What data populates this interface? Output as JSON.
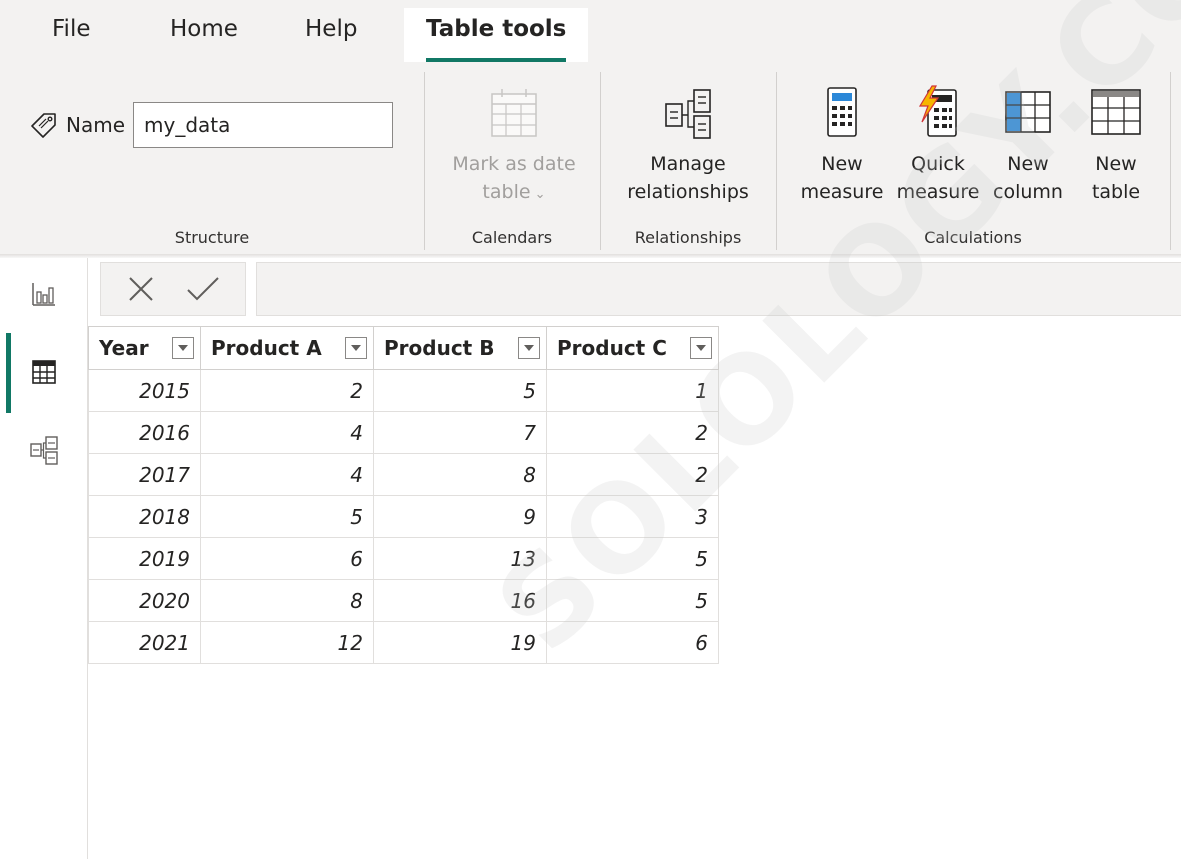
{
  "menu": {
    "tabs": [
      "File",
      "Home",
      "Help",
      "Table tools"
    ],
    "active": "Table tools"
  },
  "ribbon": {
    "structure": {
      "name_label": "Name",
      "name_value": "my_data",
      "group_label": "Structure"
    },
    "calendars": {
      "mark_date_line1": "Mark as date",
      "mark_date_line2": "table",
      "group_label": "Calendars"
    },
    "relationships": {
      "manage_line1": "Manage",
      "manage_line2": "relationships",
      "group_label": "Relationships"
    },
    "calculations": {
      "new_measure": "New\nmeasure",
      "quick_measure": "Quick\nmeasure",
      "new_column": "New\ncolumn",
      "new_table": "New\ntable",
      "group_label": "Calculations"
    }
  },
  "leftnav": {
    "items": [
      "report-view",
      "table-view",
      "model-view"
    ],
    "active": "table-view"
  },
  "table": {
    "headers": [
      "Year",
      "Product A",
      "Product B",
      "Product C"
    ],
    "rows": [
      [
        "2015",
        "2",
        "5",
        "1"
      ],
      [
        "2016",
        "4",
        "7",
        "2"
      ],
      [
        "2017",
        "4",
        "8",
        "2"
      ],
      [
        "2018",
        "5",
        "9",
        "3"
      ],
      [
        "2019",
        "6",
        "13",
        "5"
      ],
      [
        "2020",
        "8",
        "16",
        "5"
      ],
      [
        "2021",
        "12",
        "19",
        "6"
      ]
    ]
  },
  "watermark": "SOLOLOGY.COM",
  "colors": {
    "accent": "#117865",
    "ribbon_bg": "#f3f2f1"
  }
}
